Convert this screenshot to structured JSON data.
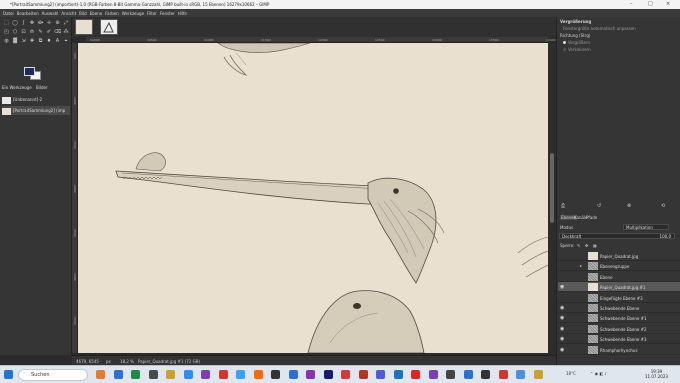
{
  "window": {
    "title": "*[PortraitSammlung2] (importiert)-1.0 (RGB-Farben 8-Bit Gamma-Ganzzahl, GIMP built-in sRGB, 15 Ebenen) 16279x10662 – GIMP",
    "controls": [
      "–",
      "□",
      "×"
    ]
  },
  "menu": [
    "Datei",
    "Bearbeiten",
    "Auswahl",
    "Ansicht",
    "Bild",
    "Ebene",
    "Farben",
    "Werkzeuge",
    "Filter",
    "Fenster",
    "Hilfe"
  ],
  "toolbox": {
    "tools": [
      "⬚",
      "◯",
      "ʃ",
      "✥",
      "⟴",
      "✛",
      "⊕",
      "⤢",
      "◰",
      "⬡",
      "⊡",
      "⟰",
      "✎",
      "✐",
      "⌫",
      "⁂",
      "◍",
      "▓",
      "⇲",
      "✚",
      "⧉",
      "♦",
      "A",
      "⌖"
    ],
    "tabs": [
      "Ein Werkzeuge",
      "Bilder"
    ],
    "images": [
      "[Unbenannt]-2",
      "[PortraitSammlung2] (imp"
    ]
  },
  "rulers": {
    "h_labels": [
      "10000",
      "10500",
      "11000",
      "11500",
      "12000",
      "12500",
      "13000",
      "13500",
      "14000"
    ],
    "v_labels": [
      "500",
      "1000",
      "1500",
      "2000",
      "2500",
      "3000",
      "3500"
    ]
  },
  "statusbar": {
    "coords": "4679, 6545",
    "unit": "px",
    "zoom": "18,2 %",
    "info": "Papier_Quadrat.jpg #1 (72 GB)"
  },
  "dock": {
    "tool_title": "Vergrößerung",
    "option_auto": "Fenstergröße automatisch anpassen",
    "direction_label": "Richtung (Strg)",
    "direction_opts": [
      "Vergrößern",
      "Verkleinern"
    ],
    "layer_tabs": [
      "Ebenen",
      "Kanäle",
      "Pfade"
    ],
    "mode_label": "Modus",
    "mode_value": "Multiplikation",
    "opacity_label": "Deckkraft",
    "opacity_value": "100,0",
    "lock_label": "Sperre:",
    "layers": [
      {
        "name": "Papier_Quadrat.jpg",
        "eye": false,
        "chain": false,
        "thumb": "light",
        "active": false
      },
      {
        "name": "Ebenengruppe",
        "eye": false,
        "chain": true,
        "thumb": "checker",
        "active": false
      },
      {
        "name": "Ebene",
        "eye": false,
        "chain": false,
        "thumb": "checker",
        "active": false
      },
      {
        "name": "Papier_Quadrat.jpg #1",
        "eye": true,
        "chain": false,
        "thumb": "light",
        "active": true
      },
      {
        "name": "Eingefügte Ebene #3",
        "eye": false,
        "chain": false,
        "thumb": "checker",
        "active": false
      },
      {
        "name": "Schwebende Ebene",
        "eye": true,
        "chain": false,
        "thumb": "checker",
        "active": false
      },
      {
        "name": "Schwebende Ebene #1",
        "eye": true,
        "chain": false,
        "thumb": "checker",
        "active": false
      },
      {
        "name": "Schwebende Ebene #2",
        "eye": true,
        "chain": false,
        "thumb": "checker",
        "active": false
      },
      {
        "name": "Schwebende Ebene #3",
        "eye": true,
        "chain": false,
        "thumb": "checker",
        "active": false
      },
      {
        "name": "Rhamphorhynchus",
        "eye": true,
        "chain": false,
        "thumb": "checker",
        "active": false
      }
    ]
  },
  "taskbar": {
    "search_placeholder": "Suchen",
    "time": "19:39",
    "date": "11.07.2023",
    "temperature": "18°C",
    "app_colors": [
      "#e27b2c",
      "#2f6fd6",
      "#1e8a4a",
      "#4a4a4a",
      "#c9a227",
      "#2d8cff",
      "#7b3fb5",
      "#d0372e",
      "#3aa0ff",
      "#ff6a00",
      "#333",
      "#2f6fd6",
      "#8b2fb5",
      "#1a1a6e",
      "#d43a3a",
      "#b83224",
      "#4e5bd6",
      "#1e73be",
      "#e02424",
      "#7b3fb5",
      "#444",
      "#2f6fd6",
      "#333",
      "#d0372e",
      "#4a90e2",
      "#c9a227"
    ]
  },
  "colors": {
    "paper": "#e9e0d0",
    "fg_color": "#1f2a5c",
    "bg_color": "#f2f2f2"
  }
}
